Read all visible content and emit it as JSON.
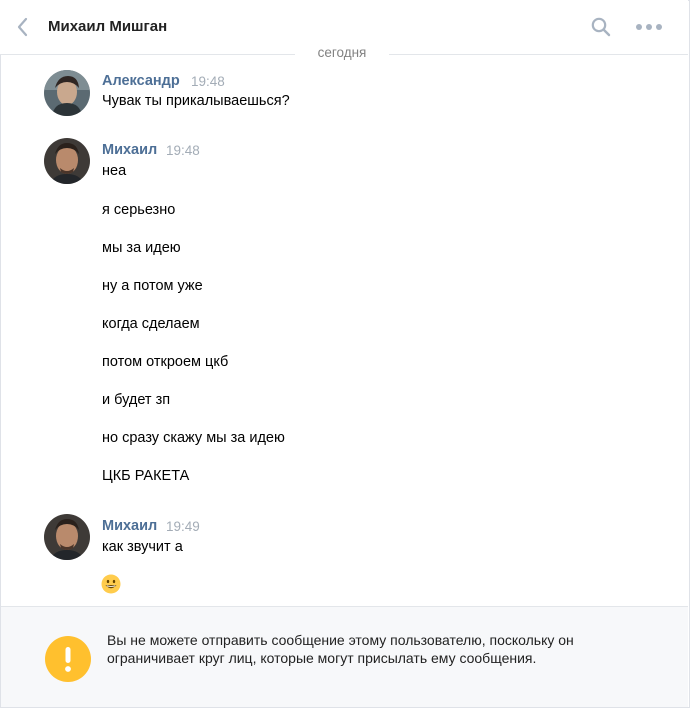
{
  "header": {
    "title": "Михаил Мишган",
    "back_icon": "chevron-left-icon",
    "search_icon": "search-icon",
    "more_icon": "more-horizontal-icon"
  },
  "date_separator": "сегодня",
  "messages": [
    {
      "author": "Александр",
      "time": "19:48",
      "lines": [
        "Чувак ты прикалываешься?"
      ]
    },
    {
      "author": "Михаил",
      "time": "19:48",
      "lines": [
        "неа",
        "я серьезно",
        "мы за идею",
        "ну а потом уже",
        "когда сделаем",
        "потом откроем цкб",
        "и будет зп",
        "но сразу скажу мы за идею",
        "ЦКБ РАКЕТА"
      ]
    },
    {
      "author": "Михаил",
      "time": "19:49",
      "lines": [
        "как звучит а"
      ],
      "emoji": "grinning-face-icon"
    }
  ],
  "notice": {
    "icon": "warning-icon",
    "text": "Вы не можете отправить сообщение этому пользователю, поскольку он ограничивает круг лиц, которые могут присылать ему сообщения."
  },
  "colors": {
    "author": "#4d6f96",
    "time": "#a3acb6",
    "warning": "#ffc02e",
    "notice_bg": "#f7f8fa",
    "icons": "#a8b3c1"
  }
}
